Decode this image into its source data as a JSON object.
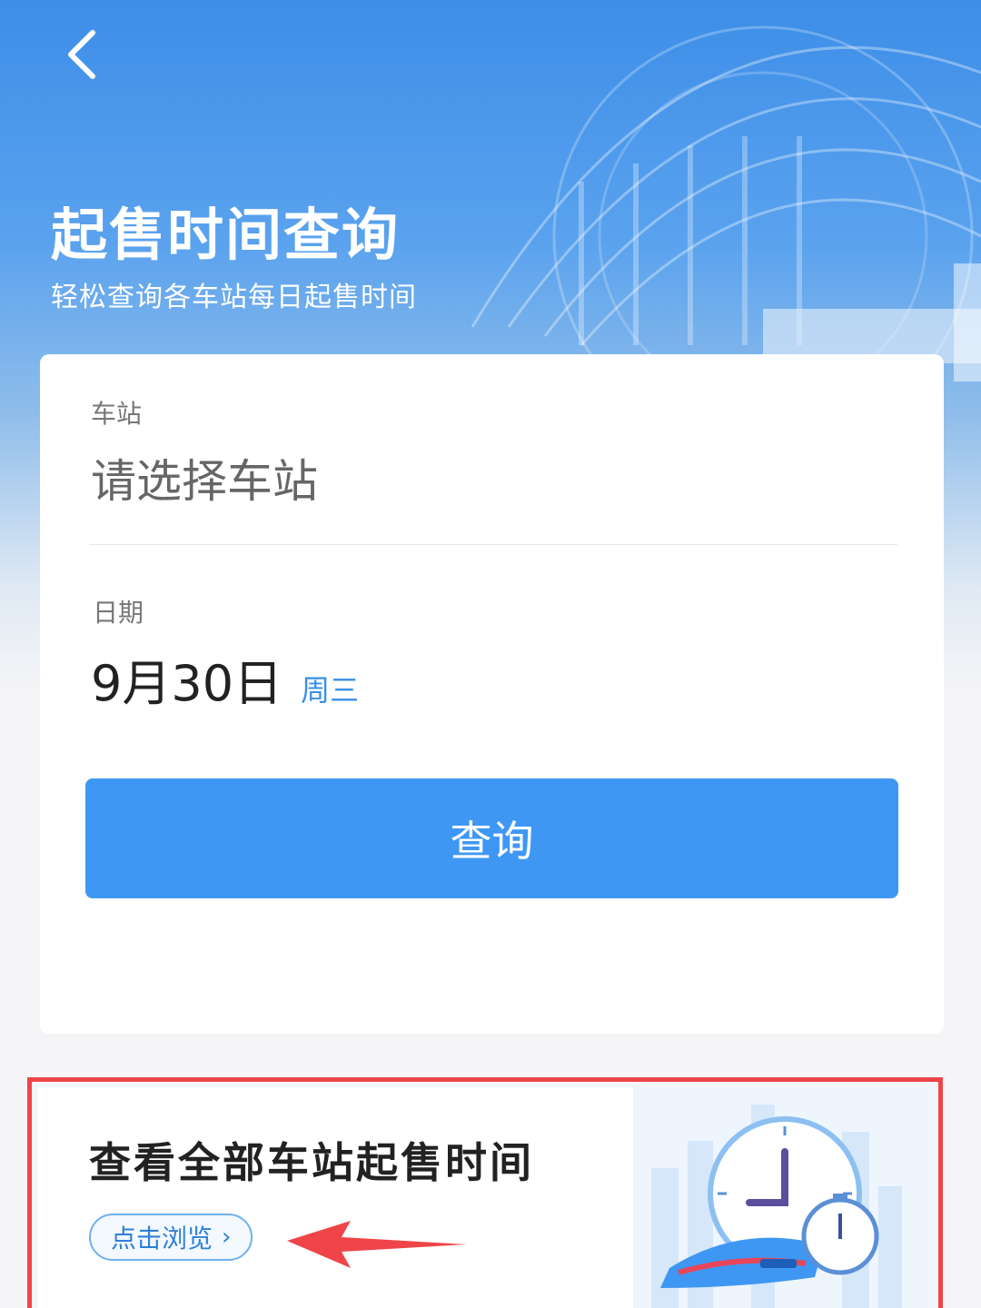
{
  "header": {
    "back_icon": "chevron-left-icon",
    "title": "起售时间查询",
    "subtitle": "轻松查询各车站每日起售时间"
  },
  "form": {
    "station_label": "车站",
    "station_placeholder": "请选择车站",
    "date_label": "日期",
    "date_value": "9月30日",
    "weekday": "周三",
    "query_button": "查询"
  },
  "promo": {
    "title": "查看全部车站起售时间",
    "browse_button": "点击浏览",
    "browse_icon": "chevron-right-icon",
    "illustration": "clock-train-illustration"
  },
  "colors": {
    "accent": "#3f97f4",
    "weekday": "#3a8fe6",
    "annotation": "#ef4548"
  }
}
